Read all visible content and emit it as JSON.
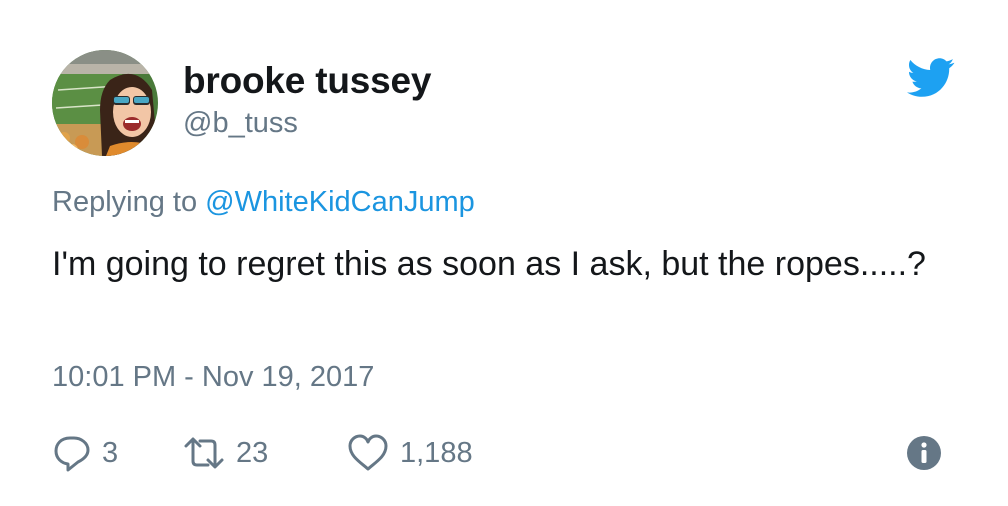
{
  "user": {
    "display_name": "brooke tussey",
    "handle": "@b_tuss",
    "avatar_icon": "profile-photo"
  },
  "reply": {
    "prefix": "Replying to ",
    "mention": "@WhiteKidCanJump"
  },
  "tweet": {
    "text": "I'm going to regret this as soon as I ask, but the ropes.....?",
    "timestamp": "10:01 PM - Nov 19, 2017"
  },
  "actions": {
    "replies": "3",
    "retweets": "23",
    "likes": "1,188"
  },
  "icons": {
    "brand": "twitter-bird-icon",
    "reply": "reply-bubble-icon",
    "retweet": "retweet-arrows-icon",
    "like": "heart-icon",
    "info": "info-icon"
  },
  "colors": {
    "text": "#14171a",
    "muted": "#657786",
    "link": "#1b95e0",
    "brand": "#1da1f2"
  }
}
